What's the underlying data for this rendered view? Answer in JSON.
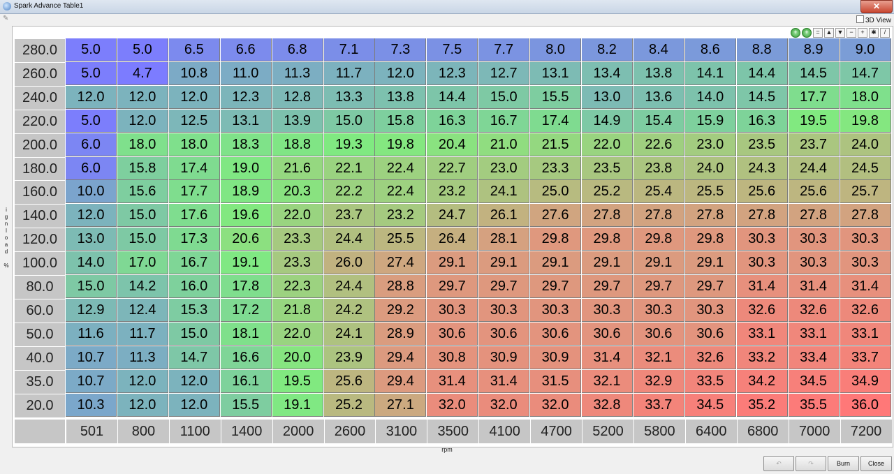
{
  "window": {
    "title": "Spark Advance Table1",
    "close_glyph": "✕"
  },
  "view3d_label": "3D View",
  "toolbar": [
    "+",
    "+",
    "=",
    "▲",
    "▼",
    "−",
    "+",
    "✱",
    "/"
  ],
  "y_axis_label": [
    "i",
    "g",
    "n",
    "l",
    "o",
    "a",
    "d",
    " ",
    "%"
  ],
  "x_axis_label": "rpm",
  "y_values": [
    "280.0",
    "260.0",
    "240.0",
    "220.0",
    "200.0",
    "180.0",
    "160.0",
    "140.0",
    "120.0",
    "100.0",
    "80.0",
    "60.0",
    "50.0",
    "40.0",
    "35.0",
    "20.0"
  ],
  "x_values": [
    "501",
    "800",
    "1100",
    "1400",
    "2000",
    "2600",
    "3100",
    "3500",
    "4100",
    "4700",
    "5200",
    "5800",
    "6400",
    "6800",
    "7000",
    "7200"
  ],
  "table": [
    [
      "5.0",
      "5.0",
      "6.5",
      "6.6",
      "6.8",
      "7.1",
      "7.3",
      "7.5",
      "7.7",
      "8.0",
      "8.2",
      "8.4",
      "8.6",
      "8.8",
      "8.9",
      "9.0"
    ],
    [
      "5.0",
      "4.7",
      "10.8",
      "11.0",
      "11.3",
      "11.7",
      "12.0",
      "12.3",
      "12.7",
      "13.1",
      "13.4",
      "13.8",
      "14.1",
      "14.4",
      "14.5",
      "14.7"
    ],
    [
      "12.0",
      "12.0",
      "12.0",
      "12.3",
      "12.8",
      "13.3",
      "13.8",
      "14.4",
      "15.0",
      "15.5",
      "13.0",
      "13.6",
      "14.0",
      "14.5",
      "17.7",
      "18.0"
    ],
    [
      "5.0",
      "12.0",
      "12.5",
      "13.1",
      "13.9",
      "15.0",
      "15.8",
      "16.3",
      "16.7",
      "17.4",
      "14.9",
      "15.4",
      "15.9",
      "16.3",
      "19.5",
      "19.8"
    ],
    [
      "6.0",
      "18.0",
      "18.0",
      "18.3",
      "18.8",
      "19.3",
      "19.8",
      "20.4",
      "21.0",
      "21.5",
      "22.0",
      "22.6",
      "23.0",
      "23.5",
      "23.7",
      "24.0"
    ],
    [
      "6.0",
      "15.8",
      "17.4",
      "19.0",
      "21.6",
      "22.1",
      "22.4",
      "22.7",
      "23.0",
      "23.3",
      "23.5",
      "23.8",
      "24.0",
      "24.3",
      "24.4",
      "24.5"
    ],
    [
      "10.0",
      "15.6",
      "17.7",
      "18.9",
      "20.3",
      "22.2",
      "22.4",
      "23.2",
      "24.1",
      "25.0",
      "25.2",
      "25.4",
      "25.5",
      "25.6",
      "25.6",
      "25.7"
    ],
    [
      "12.0",
      "15.0",
      "17.6",
      "19.6",
      "22.0",
      "23.7",
      "23.2",
      "24.7",
      "26.1",
      "27.6",
      "27.8",
      "27.8",
      "27.8",
      "27.8",
      "27.8",
      "27.8"
    ],
    [
      "13.0",
      "15.0",
      "17.3",
      "20.6",
      "23.3",
      "24.4",
      "25.5",
      "26.4",
      "28.1",
      "29.8",
      "29.8",
      "29.8",
      "29.8",
      "30.3",
      "30.3",
      "30.3"
    ],
    [
      "14.0",
      "17.0",
      "16.7",
      "19.1",
      "23.3",
      "26.0",
      "27.4",
      "29.1",
      "29.1",
      "29.1",
      "29.1",
      "29.1",
      "29.1",
      "30.3",
      "30.3",
      "30.3"
    ],
    [
      "15.0",
      "14.2",
      "16.0",
      "17.8",
      "22.3",
      "24.4",
      "28.8",
      "29.7",
      "29.7",
      "29.7",
      "29.7",
      "29.7",
      "29.7",
      "31.4",
      "31.4",
      "31.4"
    ],
    [
      "12.9",
      "12.4",
      "15.3",
      "17.2",
      "21.8",
      "24.2",
      "29.2",
      "30.3",
      "30.3",
      "30.3",
      "30.3",
      "30.3",
      "30.3",
      "32.6",
      "32.6",
      "32.6"
    ],
    [
      "11.6",
      "11.7",
      "15.0",
      "18.1",
      "22.0",
      "24.1",
      "28.9",
      "30.6",
      "30.6",
      "30.6",
      "30.6",
      "30.6",
      "30.6",
      "33.1",
      "33.1",
      "33.1"
    ],
    [
      "10.7",
      "11.3",
      "14.7",
      "16.6",
      "20.0",
      "23.9",
      "29.4",
      "30.8",
      "30.9",
      "30.9",
      "31.4",
      "32.1",
      "32.6",
      "33.2",
      "33.4",
      "33.7"
    ],
    [
      "10.7",
      "12.0",
      "12.0",
      "16.1",
      "19.5",
      "25.6",
      "29.4",
      "31.4",
      "31.4",
      "31.5",
      "32.1",
      "32.9",
      "33.5",
      "34.2",
      "34.5",
      "34.9"
    ],
    [
      "10.3",
      "12.0",
      "12.0",
      "15.5",
      "19.1",
      "25.2",
      "27.1",
      "32.0",
      "32.0",
      "32.0",
      "32.8",
      "33.7",
      "34.5",
      "35.2",
      "35.5",
      "36.0"
    ]
  ],
  "buttons": {
    "undo": "↶",
    "redo": "↷",
    "burn": "Burn",
    "close": "Close"
  }
}
